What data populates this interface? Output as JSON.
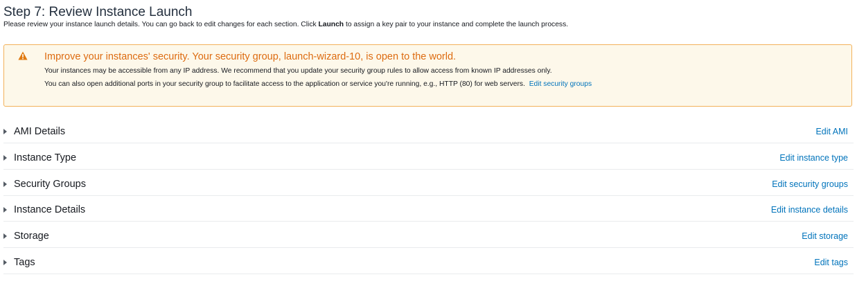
{
  "header": {
    "title": "Step 7: Review Instance Launch",
    "description_before": "Please review your instance launch details. You can go back to edit changes for each section. Click ",
    "description_bold": "Launch",
    "description_after": " to assign a key pair to your instance and complete the launch process."
  },
  "alert": {
    "icon": "warning-icon",
    "title": "Improve your instances' security. Your security group, launch-wizard-10, is open to the world.",
    "line1": "Your instances may be accessible from any IP address. We recommend that you update your security group rules to allow access from known IP addresses only.",
    "line2": "You can also open additional ports in your security group to facilitate access to the application or service you're running, e.g., HTTP (80) for web servers.",
    "link": "Edit security groups",
    "colors": {
      "background": "#fdf8ea",
      "border": "#f3b15a",
      "title": "#dd6b10"
    }
  },
  "sections": [
    {
      "label": "AMI Details",
      "edit": "Edit AMI"
    },
    {
      "label": "Instance Type",
      "edit": "Edit instance type"
    },
    {
      "label": "Security Groups",
      "edit": "Edit security groups"
    },
    {
      "label": "Instance Details",
      "edit": "Edit instance details"
    },
    {
      "label": "Storage",
      "edit": "Edit storage"
    },
    {
      "label": "Tags",
      "edit": "Edit tags"
    }
  ],
  "colors": {
    "link": "#0073bb",
    "text": "#16191f"
  }
}
